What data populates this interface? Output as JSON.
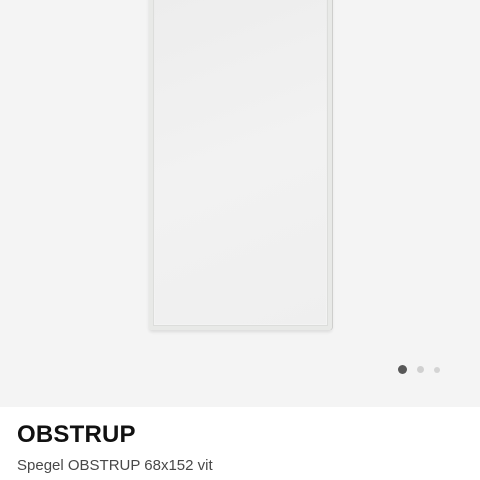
{
  "product": {
    "name": "OBSTRUP",
    "description": "Spegel OBSTRUP 68x152 vit"
  },
  "gallery": {
    "image_subject": "mirror",
    "total_images": 3,
    "active_index": 0
  },
  "colors": {
    "gallery_background": "#f4f4f4",
    "mirror_frame": "#e8e9e7",
    "dot_active": "#585858",
    "dot_inactive": "#d0d0d0"
  }
}
